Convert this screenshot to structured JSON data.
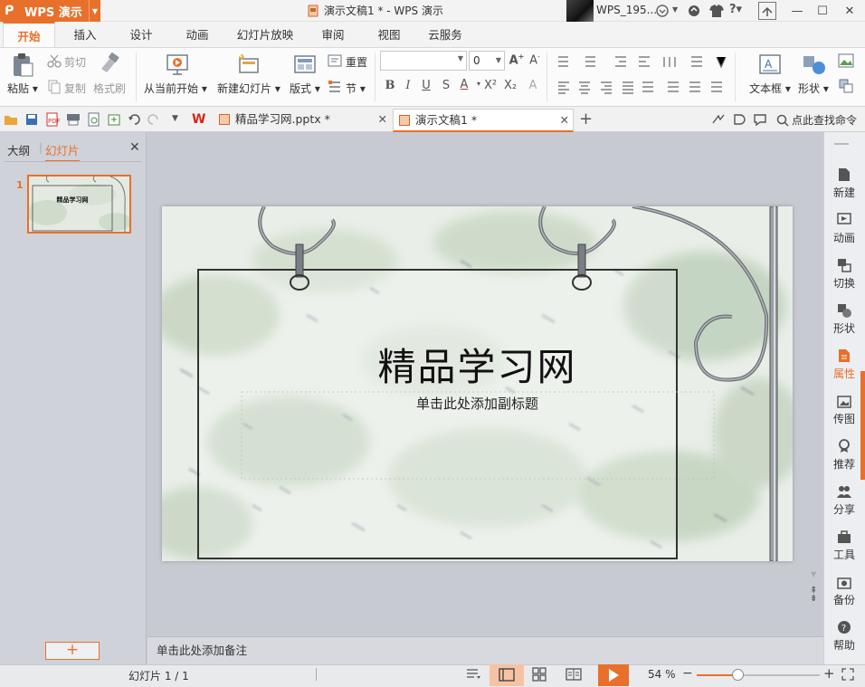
{
  "app": {
    "brand": "WPS 演示",
    "window_title": "演示文稿1 * - WPS 演示",
    "username": "WPS_195..."
  },
  "menu_tabs": [
    "开始",
    "插入",
    "设计",
    "动画",
    "幻灯片放映",
    "审阅",
    "视图",
    "云服务"
  ],
  "ribbon": {
    "paste": "粘贴",
    "cut": "剪切",
    "copy": "复制",
    "format_painter": "格式刷",
    "from_current": "从当前开始",
    "new_slide": "新建幻灯片",
    "layout": "版式",
    "reset": "重置",
    "section": "节",
    "font_name": "",
    "font_size": "0",
    "textbox": "文本框",
    "shape": "形状"
  },
  "doc_tabs": [
    {
      "label": "精品学习网.pptx *",
      "active": false
    },
    {
      "label": "演示文稿1 *",
      "active": true
    }
  ],
  "search_label": "点此查找命令",
  "left_panel": {
    "outline_tab": "大纲",
    "slides_tab": "幻灯片",
    "slide_number": "1",
    "thumb_title": "精品学习网"
  },
  "slide": {
    "title": "精品学习网",
    "subtitle": "单击此处添加副标题"
  },
  "notes_placeholder": "单击此处添加备注",
  "right_sidebar": [
    "新建",
    "动画",
    "切换",
    "形状",
    "属性",
    "传图",
    "推荐",
    "分享",
    "工具",
    "备份",
    "帮助"
  ],
  "status": {
    "slide_counter": "幻灯片 1 / 1",
    "zoom": "54 %"
  },
  "zoom_level": 0.33,
  "colors": {
    "accent": "#e8702a",
    "panel": "#cfd2d8"
  }
}
